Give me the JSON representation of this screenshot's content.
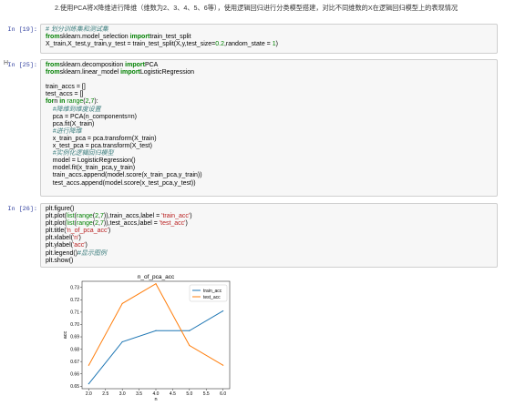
{
  "intro": "2.使用PCA将X降维进行降维（维数为2、3、4、5、6等），使用逻辑回归进行分类模型搭建，对比不同维数的X在逻辑回归模型上的表现情况",
  "run_indicator": "H",
  "cells": [
    {
      "prompt": "In [19]:",
      "lines": [
        [
          [
            "cm",
            "# 划分训练集和测试集"
          ]
        ],
        [
          [
            "kw",
            "from"
          ],
          [
            "",
            "sklearn.model_selection "
          ],
          [
            "kw",
            "import"
          ],
          [
            "",
            "train_test_split"
          ]
        ],
        [
          [
            "",
            "X_train,X_test,y_train,y_test = train_test_split(X,y,test_size="
          ],
          [
            "num",
            "0.2"
          ],
          [
            "",
            ",random_state = "
          ],
          [
            "num",
            "1"
          ],
          [
            "",
            ")"
          ]
        ]
      ]
    },
    {
      "prompt": "In [25]:",
      "lines": [
        [
          [
            "kw",
            "from"
          ],
          [
            "",
            "sklearn.decomposition "
          ],
          [
            "kw",
            "import"
          ],
          [
            "",
            "PCA"
          ]
        ],
        [
          [
            "kw",
            "from"
          ],
          [
            "",
            "sklearn.linear_model "
          ],
          [
            "kw",
            "import"
          ],
          [
            "",
            "LogisticRegression"
          ]
        ],
        [
          [
            "",
            ""
          ]
        ],
        [
          [
            "",
            "train_accs = []"
          ]
        ],
        [
          [
            "",
            "test_accs = []"
          ]
        ],
        [
          [
            "kw",
            "for"
          ],
          [
            "",
            "n "
          ],
          [
            "kw",
            "in"
          ],
          [
            "bi",
            " range"
          ],
          [
            "",
            "("
          ],
          [
            "num",
            "2"
          ],
          [
            "",
            ","
          ],
          [
            "num",
            "7"
          ],
          [
            "",
            "):"
          ]
        ],
        [
          [
            "",
            "    "
          ],
          [
            "cm",
            "#降维到维度设置"
          ]
        ],
        [
          [
            "",
            "    pca = PCA(n_components=n)"
          ]
        ],
        [
          [
            "",
            "    pca.fit(X_train)"
          ]
        ],
        [
          [
            "",
            "    "
          ],
          [
            "cm",
            "#进行降维"
          ]
        ],
        [
          [
            "",
            "    x_train_pca = pca.transform(X_train)"
          ]
        ],
        [
          [
            "",
            "    x_test_pca = pca.transform(X_test)"
          ]
        ],
        [
          [
            "",
            "    "
          ],
          [
            "cm",
            "#实例化逻辑回归模型"
          ]
        ],
        [
          [
            "",
            "    model = LogisticRegression()"
          ]
        ],
        [
          [
            "",
            "    model.fit(x_train_pca,y_train)"
          ]
        ],
        [
          [
            "",
            "    train_accs.append(model.score(x_train_pca,y_train))"
          ]
        ],
        [
          [
            "",
            "    test_accs.append(model.score(x_test_pca,y_test))"
          ]
        ]
      ]
    },
    {
      "prompt": "In [26]:",
      "lines": [
        [
          [
            "",
            "plt.figure()"
          ]
        ],
        [
          [
            "",
            "plt.plot("
          ],
          [
            "bi",
            "list"
          ],
          [
            "",
            "("
          ],
          [
            "bi",
            "range"
          ],
          [
            "",
            "("
          ],
          [
            "num",
            "2"
          ],
          [
            "",
            ","
          ],
          [
            "num",
            "7"
          ],
          [
            "",
            ")),train_accs,label = "
          ],
          [
            "str",
            "'train_acc'"
          ],
          [
            "",
            ")"
          ]
        ],
        [
          [
            "",
            "plt.plot("
          ],
          [
            "bi",
            "list"
          ],
          [
            "",
            "("
          ],
          [
            "bi",
            "range"
          ],
          [
            "",
            "("
          ],
          [
            "num",
            "2"
          ],
          [
            "",
            ","
          ],
          [
            "num",
            "7"
          ],
          [
            "",
            ")),test_accs,label = "
          ],
          [
            "str",
            "'test_acc'"
          ],
          [
            "",
            ")"
          ]
        ],
        [
          [
            "",
            "plt.title("
          ],
          [
            "str",
            "'n_of_pca_acc'"
          ],
          [
            "",
            ")"
          ]
        ],
        [
          [
            "",
            "plt.xlabel("
          ],
          [
            "str",
            "'n'"
          ],
          [
            "",
            ")"
          ]
        ],
        [
          [
            "",
            "plt.ylabel("
          ],
          [
            "str",
            "'acc'"
          ],
          [
            "",
            ")"
          ]
        ],
        [
          [
            "",
            "plt.legend()"
          ],
          [
            "cm",
            "#显示图例"
          ]
        ],
        [
          [
            "",
            "plt.show()"
          ]
        ]
      ]
    }
  ],
  "chart_data": {
    "type": "line",
    "title": "n_of_pca_acc",
    "xlabel": "n",
    "ylabel": "acc",
    "x": [
      2,
      3,
      4,
      5,
      6
    ],
    "xticks": [
      "2.0",
      "2.5",
      "3.0",
      "3.5",
      "4.0",
      "4.5",
      "5.0",
      "5.5",
      "6.0"
    ],
    "yticks": [
      "0.65",
      "0.66",
      "0.67",
      "0.68",
      "0.69",
      "0.70",
      "0.71",
      "0.72",
      "0.73"
    ],
    "xlim": [
      1.8,
      6.2
    ],
    "ylim": [
      0.648,
      0.735
    ],
    "grid": false,
    "legend_position": "upper right",
    "series": [
      {
        "name": "train_acc",
        "color": "#1f77b4",
        "values": [
          0.652,
          0.686,
          0.695,
          0.695,
          0.711
        ]
      },
      {
        "name": "test_acc",
        "color": "#ff7f0e",
        "values": [
          0.667,
          0.717,
          0.733,
          0.683,
          0.667
        ]
      }
    ]
  }
}
